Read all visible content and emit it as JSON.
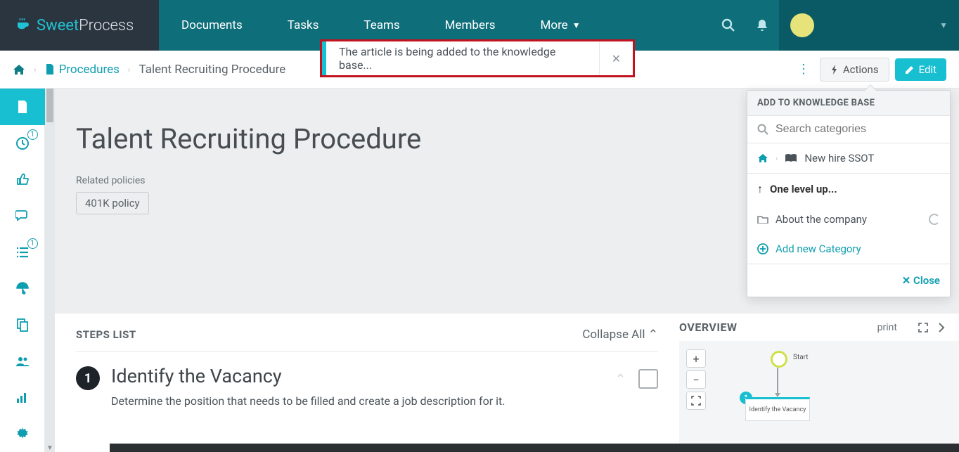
{
  "brand": {
    "sweet": "Sweet",
    "process": "Process"
  },
  "nav": {
    "documents": "Documents",
    "tasks": "Tasks",
    "teams": "Teams",
    "members": "Members",
    "more": "More"
  },
  "user": {
    "name": ""
  },
  "crumbs": {
    "procedures": "Procedures",
    "current": "Talent Recruiting Procedure"
  },
  "buttons": {
    "actions": "Actions",
    "edit": "Edit"
  },
  "toast": {
    "message": "The article is being added to the knowledge base..."
  },
  "sidebar_badges": {
    "clock": "1",
    "list": "1"
  },
  "hero": {
    "title": "Talent Recruiting Procedure",
    "related_label": "Related policies",
    "tag": "401K policy"
  },
  "steps": {
    "header": "STEPS LIST",
    "collapse": "Collapse All",
    "items": [
      {
        "num": "1",
        "title": "Identify the Vacancy",
        "desc": "Determine the position that needs to be filled and create a job description for it."
      }
    ]
  },
  "overview": {
    "title": "OVERVIEW",
    "print": "print",
    "start": "Start",
    "step1_num": "1",
    "step1_label": "Identify the Vacancy"
  },
  "kb": {
    "header": "ADD TO KNOWLEDGE BASE",
    "search_placeholder": "Search categories",
    "kb_name": "New hire SSOT",
    "up": "One level up...",
    "category": "About the company",
    "add": "Add new Category",
    "close": "Close"
  }
}
